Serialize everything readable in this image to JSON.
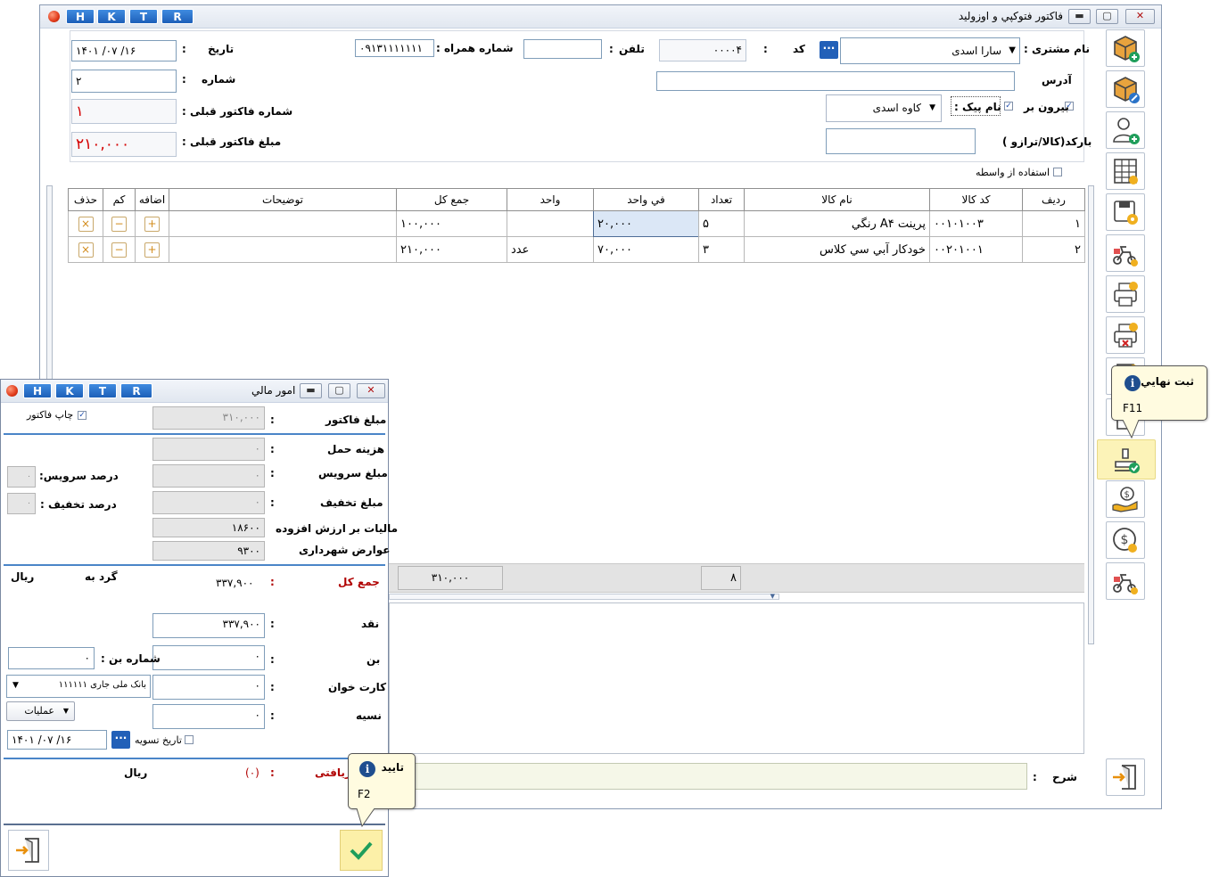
{
  "main": {
    "title": "فاکتور فتوکپي و اوزوليد",
    "hk": [
      "H",
      "K",
      "T",
      "R"
    ],
    "form": {
      "customer_label": "نام مشتری :",
      "customer_value": "سارا اسدی",
      "code_label": "کد",
      "code_colon": ":",
      "code_value": "۰۰۰۰۴",
      "phone_label": "تلفن",
      "phone_colon": ":",
      "phone_value": "",
      "mobile_label": "شماره همراه :",
      "mobile_value": "۰۹۱۳۱۱۱۱۱۱۱",
      "date_label": "تاریخ",
      "date_colon": ":",
      "date_value": "۱۴۰۱  /۰۷  /۱۶",
      "address_label": "آدرس",
      "address_value": "",
      "number_label": "شماره",
      "number_colon": ":",
      "number_value": "۲",
      "outside_label": "بیرون بر",
      "courier_label": "نام پیک :",
      "courier_value": "کاوه اسدی",
      "prev_invoice_no_label": "شماره فاکتور قبلی :",
      "prev_invoice_no_value": "۱",
      "barcode_label": "بارکد(کالا/ترازو )",
      "barcode_value": "",
      "prev_invoice_amount_label": "مبلغ فاکتور قبلی :",
      "prev_invoice_amount_value": "۲۱۰,۰۰۰",
      "intermediary_label": "استفاده از واسطه"
    },
    "grid": {
      "headers": [
        "ردیف",
        "کد کالا",
        "نام کالا",
        "تعداد",
        "في واحد",
        "واحد",
        "جمع کل",
        "توضیحات",
        "اضافه",
        "کم",
        "حذف"
      ],
      "rows": [
        {
          "idx": "۱",
          "code": "۰۰۱۰۱۰۰۳",
          "name": "پرینت A۴ رنگي",
          "qty": "۵",
          "unit_price": "۲۰,۰۰۰",
          "unit": "",
          "total": "۱۰۰,۰۰۰",
          "desc": ""
        },
        {
          "idx": "۲",
          "code": "۰۰۲۰۱۰۰۱",
          "name": "خودکار آبي سي کلاس",
          "qty": "۳",
          "unit_price": "۷۰,۰۰۰",
          "unit": "عدد",
          "total": "۲۱۰,۰۰۰",
          "desc": ""
        }
      ],
      "add_glyph": "+",
      "minus_glyph": "−",
      "delete_glyph": "×"
    },
    "totals": {
      "sum": "۳۱۰,۰۰۰",
      "count": "۸"
    },
    "desc_label": "شرح",
    "desc_colon": ":",
    "tooltip_final": {
      "title": "ثبت نهايي",
      "key": "F11"
    }
  },
  "finance": {
    "title": "امور مالي",
    "hk": [
      "H",
      "K",
      "T",
      "R"
    ],
    "print_invoice_label": "چاپ فاکتور",
    "invoice_amount_label": "مبلغ فاکتور",
    "invoice_amount_value": "۳۱۰,۰۰۰",
    "shipping_label": "هزینه حمل",
    "shipping_value": "۰",
    "service_amount_label": "مبلغ سرویس",
    "service_amount_value": "۰",
    "service_pct_label": "درصد سرویس:",
    "service_pct_value": "۰",
    "discount_amount_label": "مبلغ تخفیف",
    "discount_amount_value": "۰",
    "discount_pct_label": "درصد تخفیف :",
    "discount_pct_value": "۰",
    "vat_label": "مالیات بر ارزش افزوده",
    "vat_value": "۱۸۶۰۰",
    "municipal_label": "عوارض شهرداری",
    "municipal_value": "۹۳۰۰",
    "grand_total_label": "جمع کل",
    "grand_total_value": "۳۳۷,۹۰۰",
    "round_label": "گرد به",
    "rial_label": "ریال",
    "cash_label": "نقد",
    "cash_value": "۳۳۷,۹۰۰",
    "voucher_label": "بن",
    "voucher_value": "۰",
    "voucher_no_label": "شماره بن :",
    "voucher_no_value": "۰",
    "card_label": "کارت خوان",
    "card_value": "۰",
    "bank_value": "بانک ملی جاری ۱۱۱۱۱۱",
    "credit_label": "نسیه",
    "credit_value": "۰",
    "operations_label": "عملیات",
    "settle_date_label": "تاریخ تسویه",
    "settle_date_value": "۱۴۰۱  /۰۷  /۱۶",
    "received_label": "دریافتی",
    "received_value": "(۰)",
    "rial_label2": "ریال",
    "colon": ":",
    "tooltip_confirm": {
      "title": "تایید",
      "key": "F2"
    }
  },
  "colors": {
    "accent": "#1d5fb8",
    "selected": "#fcf3b8",
    "red": "#d40000",
    "divider": "#4a85c8"
  }
}
